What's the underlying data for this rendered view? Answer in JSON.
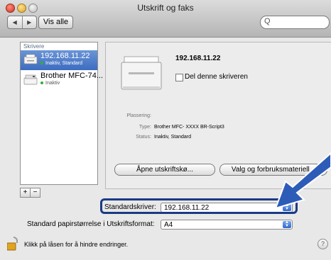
{
  "window": {
    "title": "Utskrift og faks"
  },
  "toolbar": {
    "back_icon": "◀",
    "forward_icon": "▶",
    "show_all_label": "Vis alle",
    "search_icon": "Q"
  },
  "printers": {
    "header": "Skrivere",
    "items": [
      {
        "name": "192.168.11.22",
        "status": "Inaktiv, Standard",
        "selected": true
      },
      {
        "name": "Brother MFC-74...",
        "status": "Inaktiv",
        "selected": false
      }
    ],
    "add_label": "+",
    "remove_label": "−"
  },
  "detail": {
    "name": "192.168.11.22",
    "share_label": "Del denne skriveren",
    "location_label": "Plassering:",
    "location_value": "",
    "type_label": "Type:",
    "type_value": "Brother MFC- XXXX BR-Script3",
    "status_label": "Status:",
    "status_value": "Inaktiv, Standard",
    "open_queue_label": "Åpne utskriftskø...",
    "options_label": "Valg og forbruksmateriell..."
  },
  "defaults": {
    "default_printer_label": "Standardskriver:",
    "default_printer_value": "192.168.11.22",
    "paper_size_label": "Standard papirstørrelse i Utskriftsformat:",
    "paper_size_value": "A4"
  },
  "footer": {
    "lock_text": "Klikk på låsen for å hindre endringer.",
    "help_label": "?"
  },
  "colors": {
    "highlight": "#1a3a86",
    "selection": "#3d6cc0",
    "arrow": "#2d5bb8"
  }
}
